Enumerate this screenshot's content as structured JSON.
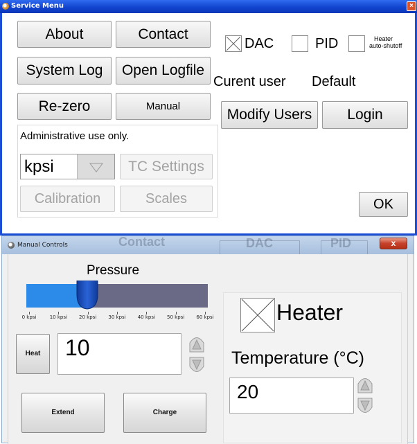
{
  "service_menu": {
    "title": "Service Menu",
    "close_glyph": "×",
    "buttons": {
      "about": "About",
      "contact": "Contact",
      "system_log": "System Log",
      "open_logfile": "Open Logfile",
      "rezero": "Re-zero",
      "manual": "Manual",
      "modify_users": "Modify Users",
      "login": "Login",
      "ok": "OK"
    },
    "checkboxes": {
      "dac": {
        "label": "DAC",
        "checked": true
      },
      "pid": {
        "label": "PID",
        "checked": false
      },
      "heater_shutoff": {
        "label_line1": "Heater",
        "label_line2": "auto-shutoff",
        "checked": false
      }
    },
    "current_user_label": "Curent user",
    "current_user_value": "Default",
    "admin": {
      "caption": "Administrative use only.",
      "unit_select_value": "kpsi",
      "tc_settings": "TC Settings",
      "calibration": "Calibration",
      "scales": "Scales"
    }
  },
  "manual_controls": {
    "title": "Manual Controls",
    "close_glyph": "x",
    "background_ghost": {
      "contact": "Contact",
      "dac": "DAC",
      "pid": "PID"
    },
    "pressure": {
      "label": "Pressure",
      "value_kpsi": 10,
      "max_kpsi": 60,
      "tick_labels": [
        "0 kpsi",
        "10 kpsi",
        "20 kpsi",
        "30 kpsi",
        "40 kpsi",
        "50 kpsi",
        "60 kpsi"
      ]
    },
    "heat_button": "Heat",
    "pressure_setpoint": "10",
    "extend_button": "Extend",
    "charge_button": "Charge",
    "heater": {
      "label": "Heater",
      "checked": true
    },
    "temperature_label": "Temperature (°C)",
    "temperature_setpoint": "20"
  },
  "colors": {
    "titlebar_blue": "#1244cf",
    "slider_fill": "#2c8be8",
    "slider_track": "#6a6a86",
    "slider_thumb": "#1a4fc2"
  }
}
